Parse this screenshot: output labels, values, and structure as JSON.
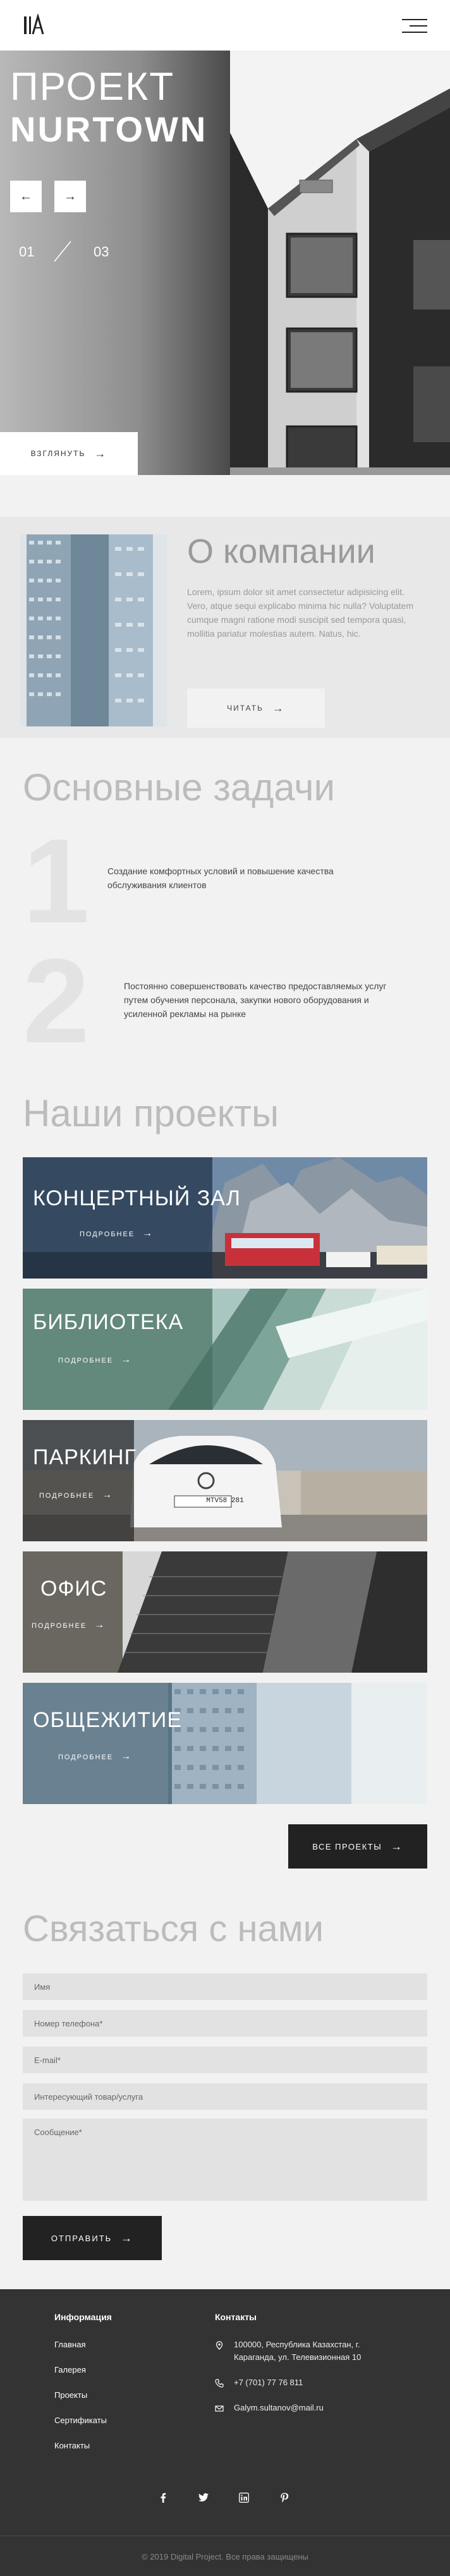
{
  "header": {
    "logo_icon": "logo-mark-icon",
    "menu_icon": "hamburger-menu-icon"
  },
  "hero": {
    "title_line1": "ПРОЕКТ",
    "title_line2": "NURTOWN",
    "prev_icon": "arrow-left-icon",
    "next_icon": "arrow-right-icon",
    "slide_current": "01",
    "slide_total": "03",
    "look_button": "ВЗГЛЯНУТЬ"
  },
  "about": {
    "title": "О компании",
    "text": "Lorem, ipsum dolor sit amet consectetur adipisicing elit. Vero, atque sequi explicabo minima hic nulla? Voluptatem cumque magni ratione modi suscipit sed tempora quasi, mollitia pariatur molestias autem. Natus, hic.",
    "read_button": "ЧИТАТЬ"
  },
  "tasks": {
    "title": "Основные задачи",
    "items": [
      {
        "num": "1",
        "text": "Создание комфортных условий и повышение качества обслуживания клиентов"
      },
      {
        "num": "2",
        "text": "Постоянно совершенствовать качество предоставляемых услуг путем обучения персонала, закупки нового оборудования и усиленной рекламы на рынке"
      }
    ]
  },
  "projects": {
    "title": "Наши проекты",
    "more_label": "ПОДРОБНЕЕ",
    "items": [
      {
        "title": "КОНЦЕРТНЫЙ ЗАЛ"
      },
      {
        "title": "БИБЛИОТЕКА"
      },
      {
        "title": "ПАРКИНГ",
        "plate": "MTV58 281"
      },
      {
        "title": "ОФИС"
      },
      {
        "title": "ОБЩЕЖИТИЕ"
      }
    ],
    "all_button": "ВСЕ ПРОЕКТЫ"
  },
  "contact": {
    "title": "Связаться с нами",
    "name_placeholder": "Имя",
    "phone_placeholder": "Номер телефона*",
    "email_placeholder": "E-mail*",
    "product_placeholder": "Интересующий товар/услуга",
    "message_placeholder": "Сообщение*",
    "send_button": "ОТПРАВИТЬ"
  },
  "footer": {
    "info_title": "Информация",
    "links": [
      "Главная",
      "Галерея",
      "Проекты",
      "Сертификаты",
      "Контакты"
    ],
    "contacts_title": "Контакты",
    "address": "100000, Республика Казахстан, г. Караганда, ул. Телевизионная 10",
    "phone": "+7 (701) 77 76 811",
    "email": "Galym.sultanov@mail.ru",
    "social_icons": [
      "facebook-icon",
      "twitter-icon",
      "linkedin-icon",
      "pinterest-icon"
    ],
    "copyright": "© 2019 Digital Project. Все права защищены"
  }
}
